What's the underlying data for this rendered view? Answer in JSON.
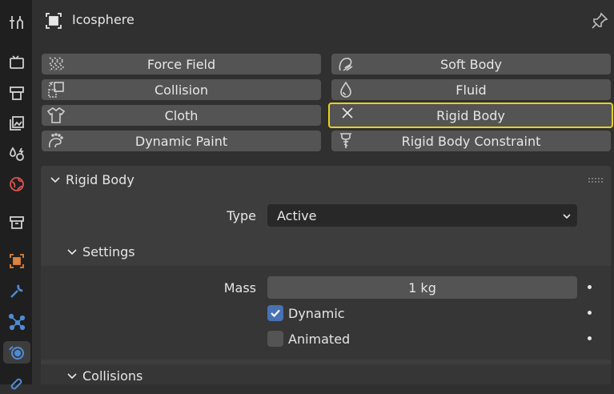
{
  "object": {
    "name": "Icosphere"
  },
  "physics_buttons": {
    "force_field": "Force Field",
    "soft_body": "Soft Body",
    "collision": "Collision",
    "fluid": "Fluid",
    "cloth": "Cloth",
    "rigid_body": "Rigid Body",
    "dynamic_paint": "Dynamic Paint",
    "rigid_body_constraint": "Rigid Body Constraint"
  },
  "rigid_body_panel": {
    "title": "Rigid Body",
    "type_label": "Type",
    "type_value": "Active",
    "settings": {
      "title": "Settings",
      "mass_label": "Mass",
      "mass_value": "1 kg",
      "dynamic_label": "Dynamic",
      "dynamic_checked": true,
      "animated_label": "Animated",
      "animated_checked": false
    },
    "collisions_title": "Collisions"
  },
  "colors": {
    "accent": "#4772b3",
    "highlight_border": "#e5d31c",
    "active_tab_icon": "#4f8bd6"
  },
  "sidebar_icons": [
    "tool-icon",
    "render-icon",
    "output-icon",
    "view-layer-icon",
    "scene-icon",
    "world-icon",
    "collection-icon",
    "object-icon",
    "modifier-icon",
    "particles-icon",
    "physics-icon",
    "constraints-icon"
  ]
}
